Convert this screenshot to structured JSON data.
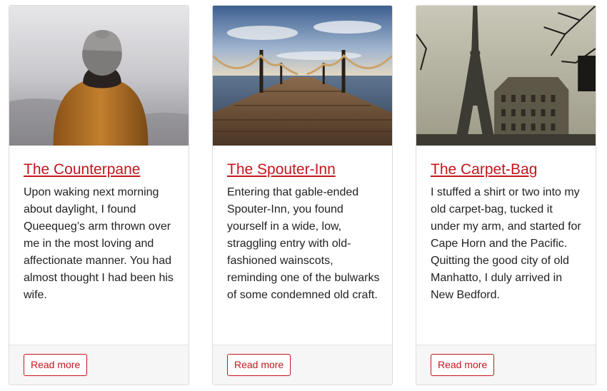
{
  "cards": [
    {
      "title": "The Counterpane",
      "text": "Upon waking next morning about daylight, I found Queequeg’s arm thrown over me in the most loving and affectionate manner. You had almost thought I had been his wife.",
      "button": "Read more",
      "image_icon": "person-in-fog-photo"
    },
    {
      "title": "The Spouter-Inn",
      "text": "Entering that gable-ended Spouter-Inn, you found yourself in a wide, low, straggling entry with old-fashioned wainscots, reminding one of the bulwarks of some condemned old craft.",
      "button": "Read more",
      "image_icon": "pier-over-sea-photo"
    },
    {
      "title": "The Carpet-Bag",
      "text": "I stuffed a shirt or two into my old carpet-bag, tucked it under my arm, and started for Cape Horn and the Pacific. Quitting the good city of old Manhatto, I duly arrived in New Bedford.",
      "button": "Read more",
      "image_icon": "eiffel-tower-photo"
    }
  ],
  "colors": {
    "accent": "#c4161c",
    "footer_bg": "#f6f6f6",
    "border": "#dcdcdc"
  }
}
